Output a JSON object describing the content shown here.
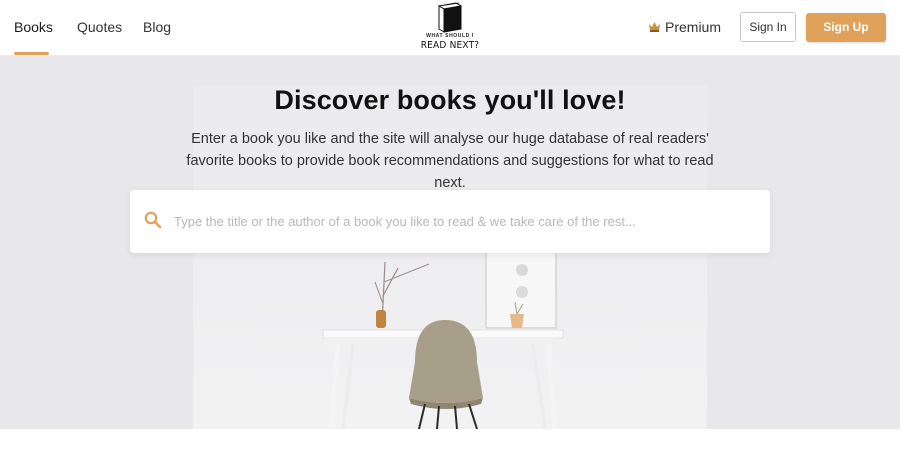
{
  "nav": {
    "items": [
      {
        "label": "Books",
        "active": true
      },
      {
        "label": "Quotes",
        "active": false
      },
      {
        "label": "Blog",
        "active": false
      }
    ]
  },
  "logo": {
    "line1": "WHAT SHOULD I",
    "line2": "READ NEXT?"
  },
  "actions": {
    "premium_label": "Premium",
    "signin_label": "Sign In",
    "signup_label": "Sign Up"
  },
  "hero": {
    "title": "Discover books you'll love!",
    "subtitle": "Enter a book you like and the site will analyse our huge database of real readers' favorite books to provide book recommendations and suggestions for what to read next."
  },
  "search": {
    "placeholder": "Type the title or the author of a book you like to read & we take care of the rest...",
    "value": ""
  },
  "colors": {
    "accent": "#e0a25a",
    "hero_bg": "#e8e8ea"
  },
  "icons": {
    "search": "search-icon",
    "premium": "crown-icon",
    "logo": "book-logo-icon"
  }
}
